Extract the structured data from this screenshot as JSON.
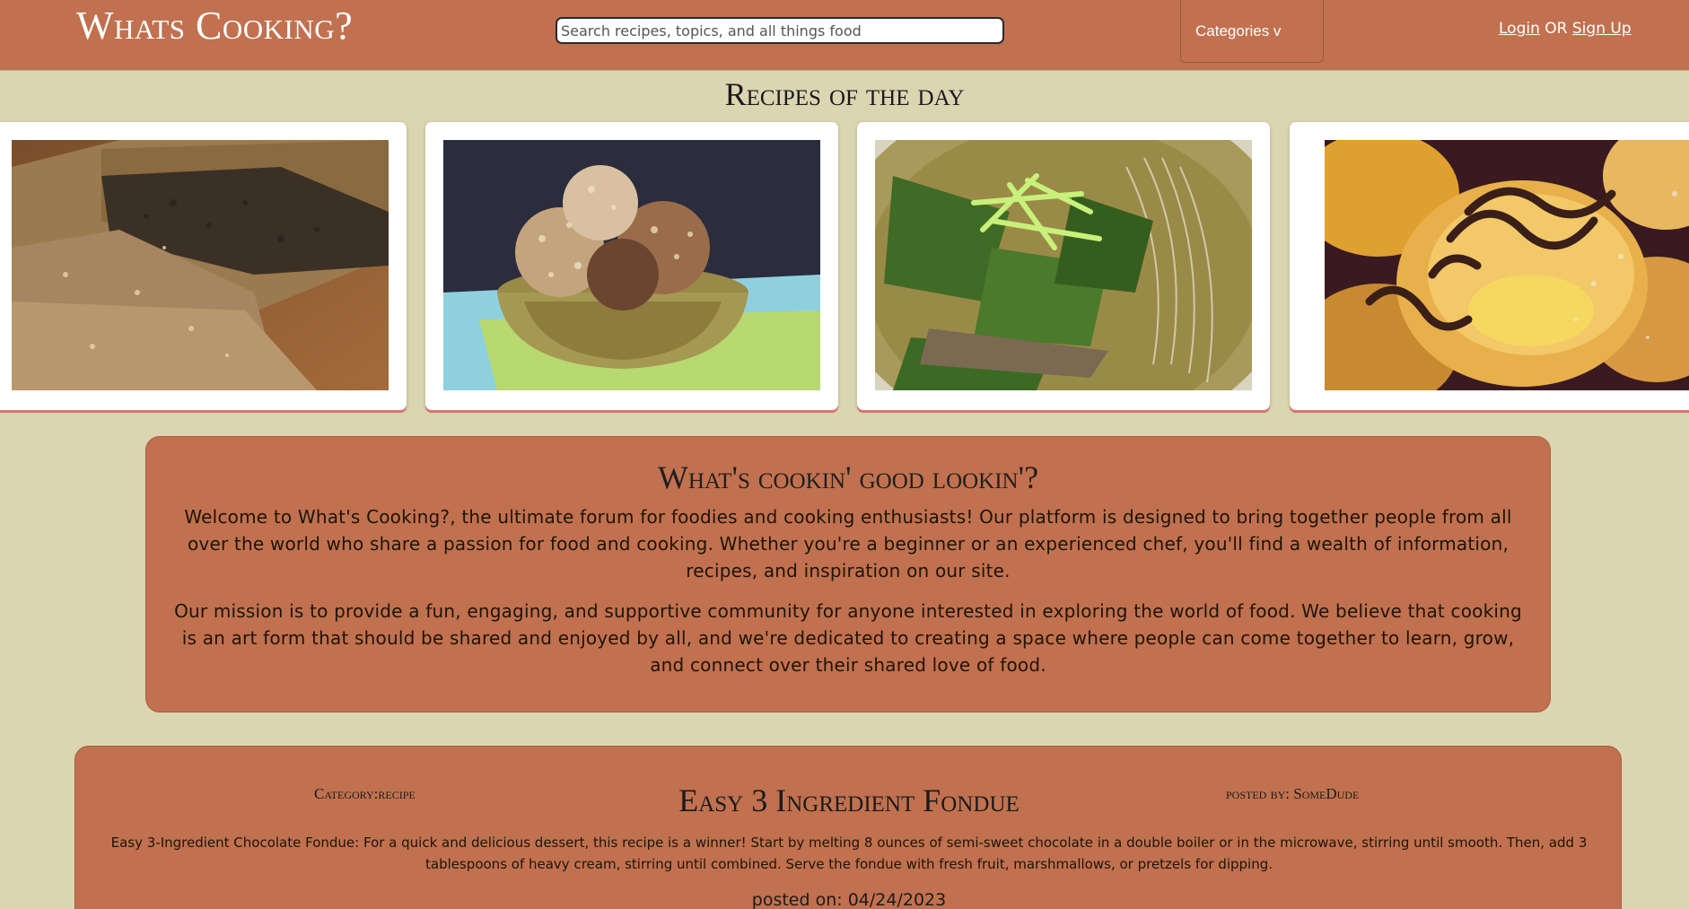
{
  "header": {
    "brand": "Whats Cooking?",
    "search_placeholder": "Search recipes, topics, and all things food",
    "categories_label": "Categories v",
    "login_label": "Login",
    "or_label": "OR",
    "signup_label": "Sign Up"
  },
  "recipes_of_day": {
    "title": "Recipes of the day",
    "items": [
      {
        "name": "seeded-bread-photo"
      },
      {
        "name": "energy-balls-photo"
      },
      {
        "name": "noodle-soup-photo"
      },
      {
        "name": "cream-puffs-photo"
      }
    ]
  },
  "about": {
    "heading": "What's cookin' good lookin'?",
    "paragraphs": [
      "Welcome to What's Cooking?, the ultimate forum for foodies and cooking enthusiasts! Our platform is designed to bring together people from all over the world who share a passion for food and cooking. Whether you're a beginner or an experienced chef, you'll find a wealth of information, recipes, and inspiration on our site.",
      "Our mission is to provide a fun, engaging, and supportive community for anyone interested in exploring the world of food. We believe that cooking is an art form that should be shared and enjoyed by all, and we're dedicated to creating a space where people can come together to learn, grow, and connect over their shared love of food."
    ]
  },
  "post": {
    "category": "Category:recipe",
    "posted_by": "posted by: SomeDude",
    "title": "Easy 3 Ingredient Fondue",
    "body": "Easy 3-Ingredient Chocolate Fondue: For a quick and delicious dessert, this recipe is a winner! Start by melting 8 ounces of semi-sweet chocolate in a double boiler or in the microwave, stirring until smooth. Then, add 3 tablespoons of heavy cream, stirring until combined. Serve the fondue with fresh fruit, marshmallows, or pretzels for dipping.",
    "posted_on": "posted on: 04/24/2023"
  },
  "colors": {
    "header_bg": "#c1714f",
    "page_bg": "#dbd5b1",
    "card_shadow": "#d4756e"
  }
}
